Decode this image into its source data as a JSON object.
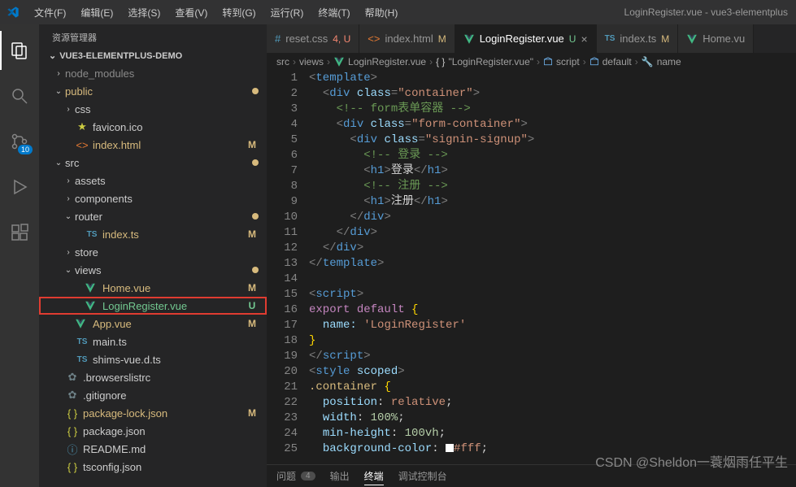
{
  "window_title": "LoginRegister.vue - vue3-elementplus",
  "menu": [
    "文件(F)",
    "编辑(E)",
    "选择(S)",
    "查看(V)",
    "转到(G)",
    "运行(R)",
    "终端(T)",
    "帮助(H)"
  ],
  "sidebar_title": "资源管理器",
  "sidebar_header": "VUE3-ELEMENTPLUS-DEMO",
  "scm_badge": "10",
  "tree": [
    {
      "depth": 1,
      "arrow": "›",
      "kind": "folder",
      "label": "node_modules",
      "dim": true
    },
    {
      "depth": 1,
      "arrow": "⌄",
      "kind": "folder",
      "label": "public",
      "tint": "public",
      "dot": true
    },
    {
      "depth": 2,
      "arrow": "›",
      "kind": "folder",
      "label": "css"
    },
    {
      "depth": 2,
      "icon": "star",
      "label": "favicon.ico"
    },
    {
      "depth": 2,
      "icon": "html",
      "label": "index.html",
      "status": "M",
      "git": "m"
    },
    {
      "depth": 1,
      "arrow": "⌄",
      "kind": "folder",
      "label": "src",
      "dot": true
    },
    {
      "depth": 2,
      "arrow": "›",
      "kind": "folder",
      "label": "assets"
    },
    {
      "depth": 2,
      "arrow": "›",
      "kind": "folder",
      "label": "components"
    },
    {
      "depth": 2,
      "arrow": "⌄",
      "kind": "folder",
      "label": "router",
      "dot": true
    },
    {
      "depth": 3,
      "icon": "ts",
      "label": "index.ts",
      "status": "M",
      "git": "m"
    },
    {
      "depth": 2,
      "arrow": "›",
      "kind": "folder",
      "label": "store"
    },
    {
      "depth": 2,
      "arrow": "⌄",
      "kind": "folder",
      "label": "views",
      "dot": true
    },
    {
      "depth": 3,
      "icon": "vue",
      "label": "Home.vue",
      "status": "M",
      "git": "m"
    },
    {
      "depth": 3,
      "icon": "vue",
      "label": "LoginRegister.vue",
      "status": "U",
      "git": "u",
      "hl": true
    },
    {
      "depth": 2,
      "icon": "vue",
      "label": "App.vue",
      "status": "M",
      "git": "m"
    },
    {
      "depth": 2,
      "icon": "ts",
      "label": "main.ts"
    },
    {
      "depth": 2,
      "icon": "ts",
      "label": "shims-vue.d.ts"
    },
    {
      "depth": 1,
      "icon": "gear",
      "label": ".browserslistrc"
    },
    {
      "depth": 1,
      "icon": "gear",
      "label": ".gitignore"
    },
    {
      "depth": 1,
      "icon": "json",
      "label": "package-lock.json",
      "status": "M",
      "git": "m"
    },
    {
      "depth": 1,
      "icon": "json",
      "label": "package.json"
    },
    {
      "depth": 1,
      "icon": "info",
      "label": "README.md"
    },
    {
      "depth": 1,
      "icon": "json",
      "label": "tsconfig.json"
    }
  ],
  "tabs": [
    {
      "icon": "hash",
      "name": "reset.css",
      "suffix": "4, U",
      "cls": "cnt"
    },
    {
      "icon": "html",
      "name": "index.html",
      "suffix": "M",
      "cls": "M"
    },
    {
      "icon": "vue",
      "name": "LoginRegister.vue",
      "suffix": "U",
      "cls": "U",
      "active": true,
      "close": true
    },
    {
      "icon": "ts",
      "name": "index.ts",
      "suffix": "M",
      "cls": "M"
    },
    {
      "icon": "vue",
      "name": "Home.vu"
    }
  ],
  "breadcrumb": [
    {
      "label": "src"
    },
    {
      "label": "views"
    },
    {
      "icon": "vue",
      "label": "LoginRegister.vue"
    },
    {
      "icon": "braces",
      "label": "\"LoginRegister.vue\""
    },
    {
      "icon": "cube",
      "label": "script"
    },
    {
      "icon": "cube",
      "label": "default"
    },
    {
      "icon": "wrench",
      "label": "name"
    }
  ],
  "code": [
    "<span class='tag'>&lt;</span><span class='tagname'>template</span><span class='tag'>&gt;</span>",
    "  <span class='tag'>&lt;</span><span class='tagname'>div</span> <span class='attr'>class</span><span class='tag'>=</span><span class='str'>\"container\"</span><span class='tag'>&gt;</span>",
    "    <span class='comment'>&lt;!-- form表单容器 --&gt;</span>",
    "    <span class='tag'>&lt;</span><span class='tagname'>div</span> <span class='attr'>class</span><span class='tag'>=</span><span class='str'>\"form-container\"</span><span class='tag'>&gt;</span>",
    "      <span class='tag'>&lt;</span><span class='tagname'>div</span> <span class='attr'>class</span><span class='tag'>=</span><span class='str'>\"signin-signup\"</span><span class='tag'>&gt;</span>",
    "        <span class='comment'>&lt;!-- 登录 --&gt;</span>",
    "        <span class='tag'>&lt;</span><span class='tagname'>h1</span><span class='tag'>&gt;</span><span class='txt'>登录</span><span class='tag'>&lt;/</span><span class='tagname'>h1</span><span class='tag'>&gt;</span>",
    "        <span class='comment'>&lt;!-- 注册 --&gt;</span>",
    "        <span class='tag'>&lt;</span><span class='tagname'>h1</span><span class='tag'>&gt;</span><span class='txt'>注册</span><span class='tag'>&lt;/</span><span class='tagname'>h1</span><span class='tag'>&gt;</span>",
    "      <span class='tag'>&lt;/</span><span class='tagname'>div</span><span class='tag'>&gt;</span>",
    "    <span class='tag'>&lt;/</span><span class='tagname'>div</span><span class='tag'>&gt;</span>",
    "  <span class='tag'>&lt;/</span><span class='tagname'>div</span><span class='tag'>&gt;</span>",
    "<span class='tag'>&lt;/</span><span class='tagname'>template</span><span class='tag'>&gt;</span>",
    "",
    "<span class='tag'>&lt;</span><span class='tagname'>script</span><span class='tag'>&gt;</span>",
    "<span class='kw2'>export</span> <span class='kw2'>default</span> <span class='yellow'>{</span>",
    "  <span class='prop'>name:</span> <span class='str'>'LoginRegister'</span>",
    "<span class='yellow'>}</span>",
    "<span class='tag'>&lt;/</span><span class='tagname'>script</span><span class='tag'>&gt;</span>",
    "<span class='tag'>&lt;</span><span class='tagname'>style</span> <span class='attr'>scoped</span><span class='tag'>&gt;</span>",
    "<span class='sel'>.container</span> <span class='yellow'>{</span>",
    "  <span class='prop'>position</span>: <span class='val'>relative</span>;",
    "  <span class='prop'>width</span>: <span class='num'>100%</span>;",
    "  <span class='prop'>min-height</span>: <span class='num'>100vh</span>;",
    "  <span class='prop'>background-color</span>: <span style='display:inline-block;width:10px;height:10px;background:#fff;vertical-align:middle'></span><span class='val'>#fff</span>;"
  ],
  "panel": {
    "problems": "问题",
    "problems_count": "4",
    "output": "输出",
    "terminal": "终端",
    "debug": "调试控制台"
  },
  "watermark": "CSDN @Sheldon一蓑烟雨任平生"
}
